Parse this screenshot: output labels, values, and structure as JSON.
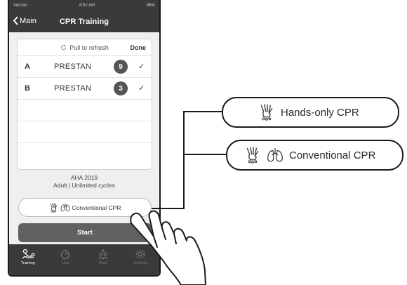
{
  "status_bar": {
    "carrier": "Verizon",
    "time": "8:52 AM",
    "battery": "86%"
  },
  "nav": {
    "back_label": "Main",
    "title": "CPR Training"
  },
  "card": {
    "refresh_label": "Pull to refresh",
    "done_label": "Done",
    "rows": [
      {
        "letter": "A",
        "name": "PRESTAN",
        "count": "9",
        "check": "✓"
      },
      {
        "letter": "B",
        "name": "PRESTAN",
        "count": "3",
        "check": "✓"
      }
    ]
  },
  "mode_info": {
    "guideline": "AHA 2019",
    "detail": "Adult | Unlimited cycles"
  },
  "mode_toggle": {
    "label": "Conventional CPR"
  },
  "start_button": {
    "label": "Start"
  },
  "tabs": [
    {
      "label": "Training",
      "icon": "rescuer-icon",
      "active": true
    },
    {
      "label": "Link",
      "icon": "link-icon",
      "active": false
    },
    {
      "label": "Data",
      "icon": "data-icon",
      "active": false
    },
    {
      "label": "Settings",
      "icon": "gear-icon",
      "active": false
    }
  ],
  "callouts": {
    "hands_only": {
      "label": "Hands-only CPR",
      "icons": [
        "hands-icon"
      ]
    },
    "conventional": {
      "label": "Conventional CPR",
      "icons": [
        "hands-icon",
        "lungs-icon"
      ]
    }
  },
  "colors": {
    "bar": "#3a3a3a",
    "start_button": "#616161",
    "badge": "#555555",
    "content_bg": "#efefef"
  }
}
